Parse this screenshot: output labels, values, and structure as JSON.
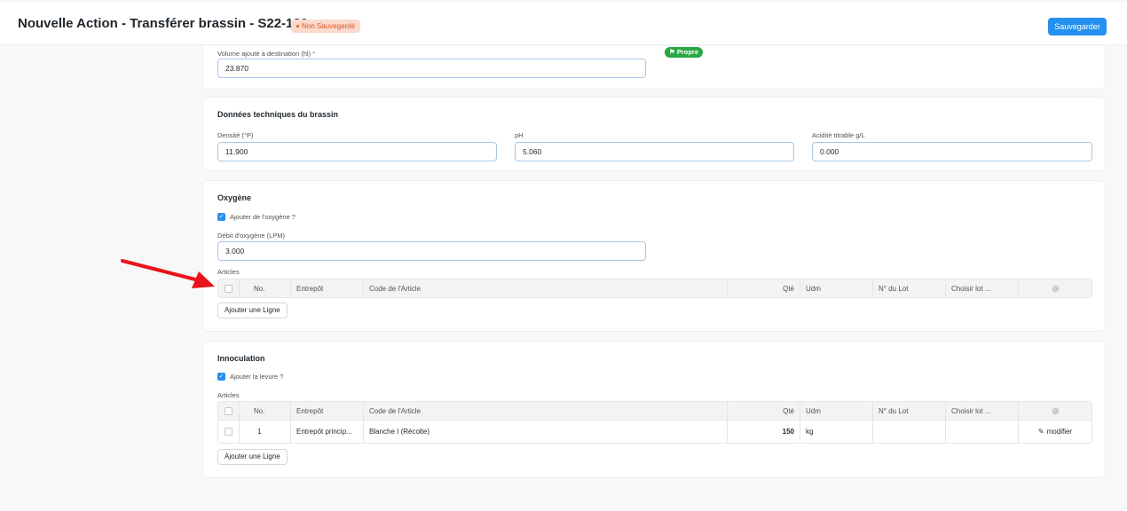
{
  "header": {
    "title": "Nouvelle Action - Transférer brassin - S22-139",
    "status_badge": "Non Sauvegardé",
    "save_label": "Sauvegarder"
  },
  "volume_card": {
    "volume_label": "Volume ajouté à destination (hl)",
    "required_mark": "*",
    "volume_value": "23.870",
    "tag": "Propre"
  },
  "tech_card": {
    "title": "Données techniques du brassin",
    "density_label": "Densité (°P)",
    "density_value": "11.900",
    "ph_label": "pH",
    "ph_value": "5.060",
    "acidity_label": "Acidité titrable g/L",
    "acidity_value": "0.000"
  },
  "oxygen_card": {
    "title": "Oxygène",
    "add_oxygen_label": "Ajouter de l'oxygène ?",
    "flow_label": "Débit d'oxygène (LPM)",
    "flow_value": "3.000",
    "articles_label": "Articles",
    "add_row_label": "Ajouter une Ligne"
  },
  "inoc_card": {
    "title": "Innoculation",
    "add_yeast_label": "Ajouter la levure ?",
    "articles_label": "Articles",
    "add_row_label": "Ajouter une Ligne",
    "rows": [
      {
        "no": "1",
        "warehouse": "Entrepôt princip...",
        "item_code": "Blanche I (Récolte)",
        "qty": "150",
        "uom": "kg",
        "lot": "",
        "choose_lot": "",
        "edit": "modifier"
      }
    ]
  },
  "table_columns": {
    "no": "No.",
    "warehouse": "Entrepôt",
    "item_code": "Code de l'Article",
    "qty": "Qté",
    "uom": "Udm",
    "lot": "N° du Lot",
    "choose_lot": "Choisir lot ..."
  },
  "colors": {
    "primary": "#2490ef",
    "badge_bg": "#fcd9cc",
    "badge_text": "#e0592a",
    "tag_green": "#28a745",
    "arrow_red": "#e8141b"
  }
}
